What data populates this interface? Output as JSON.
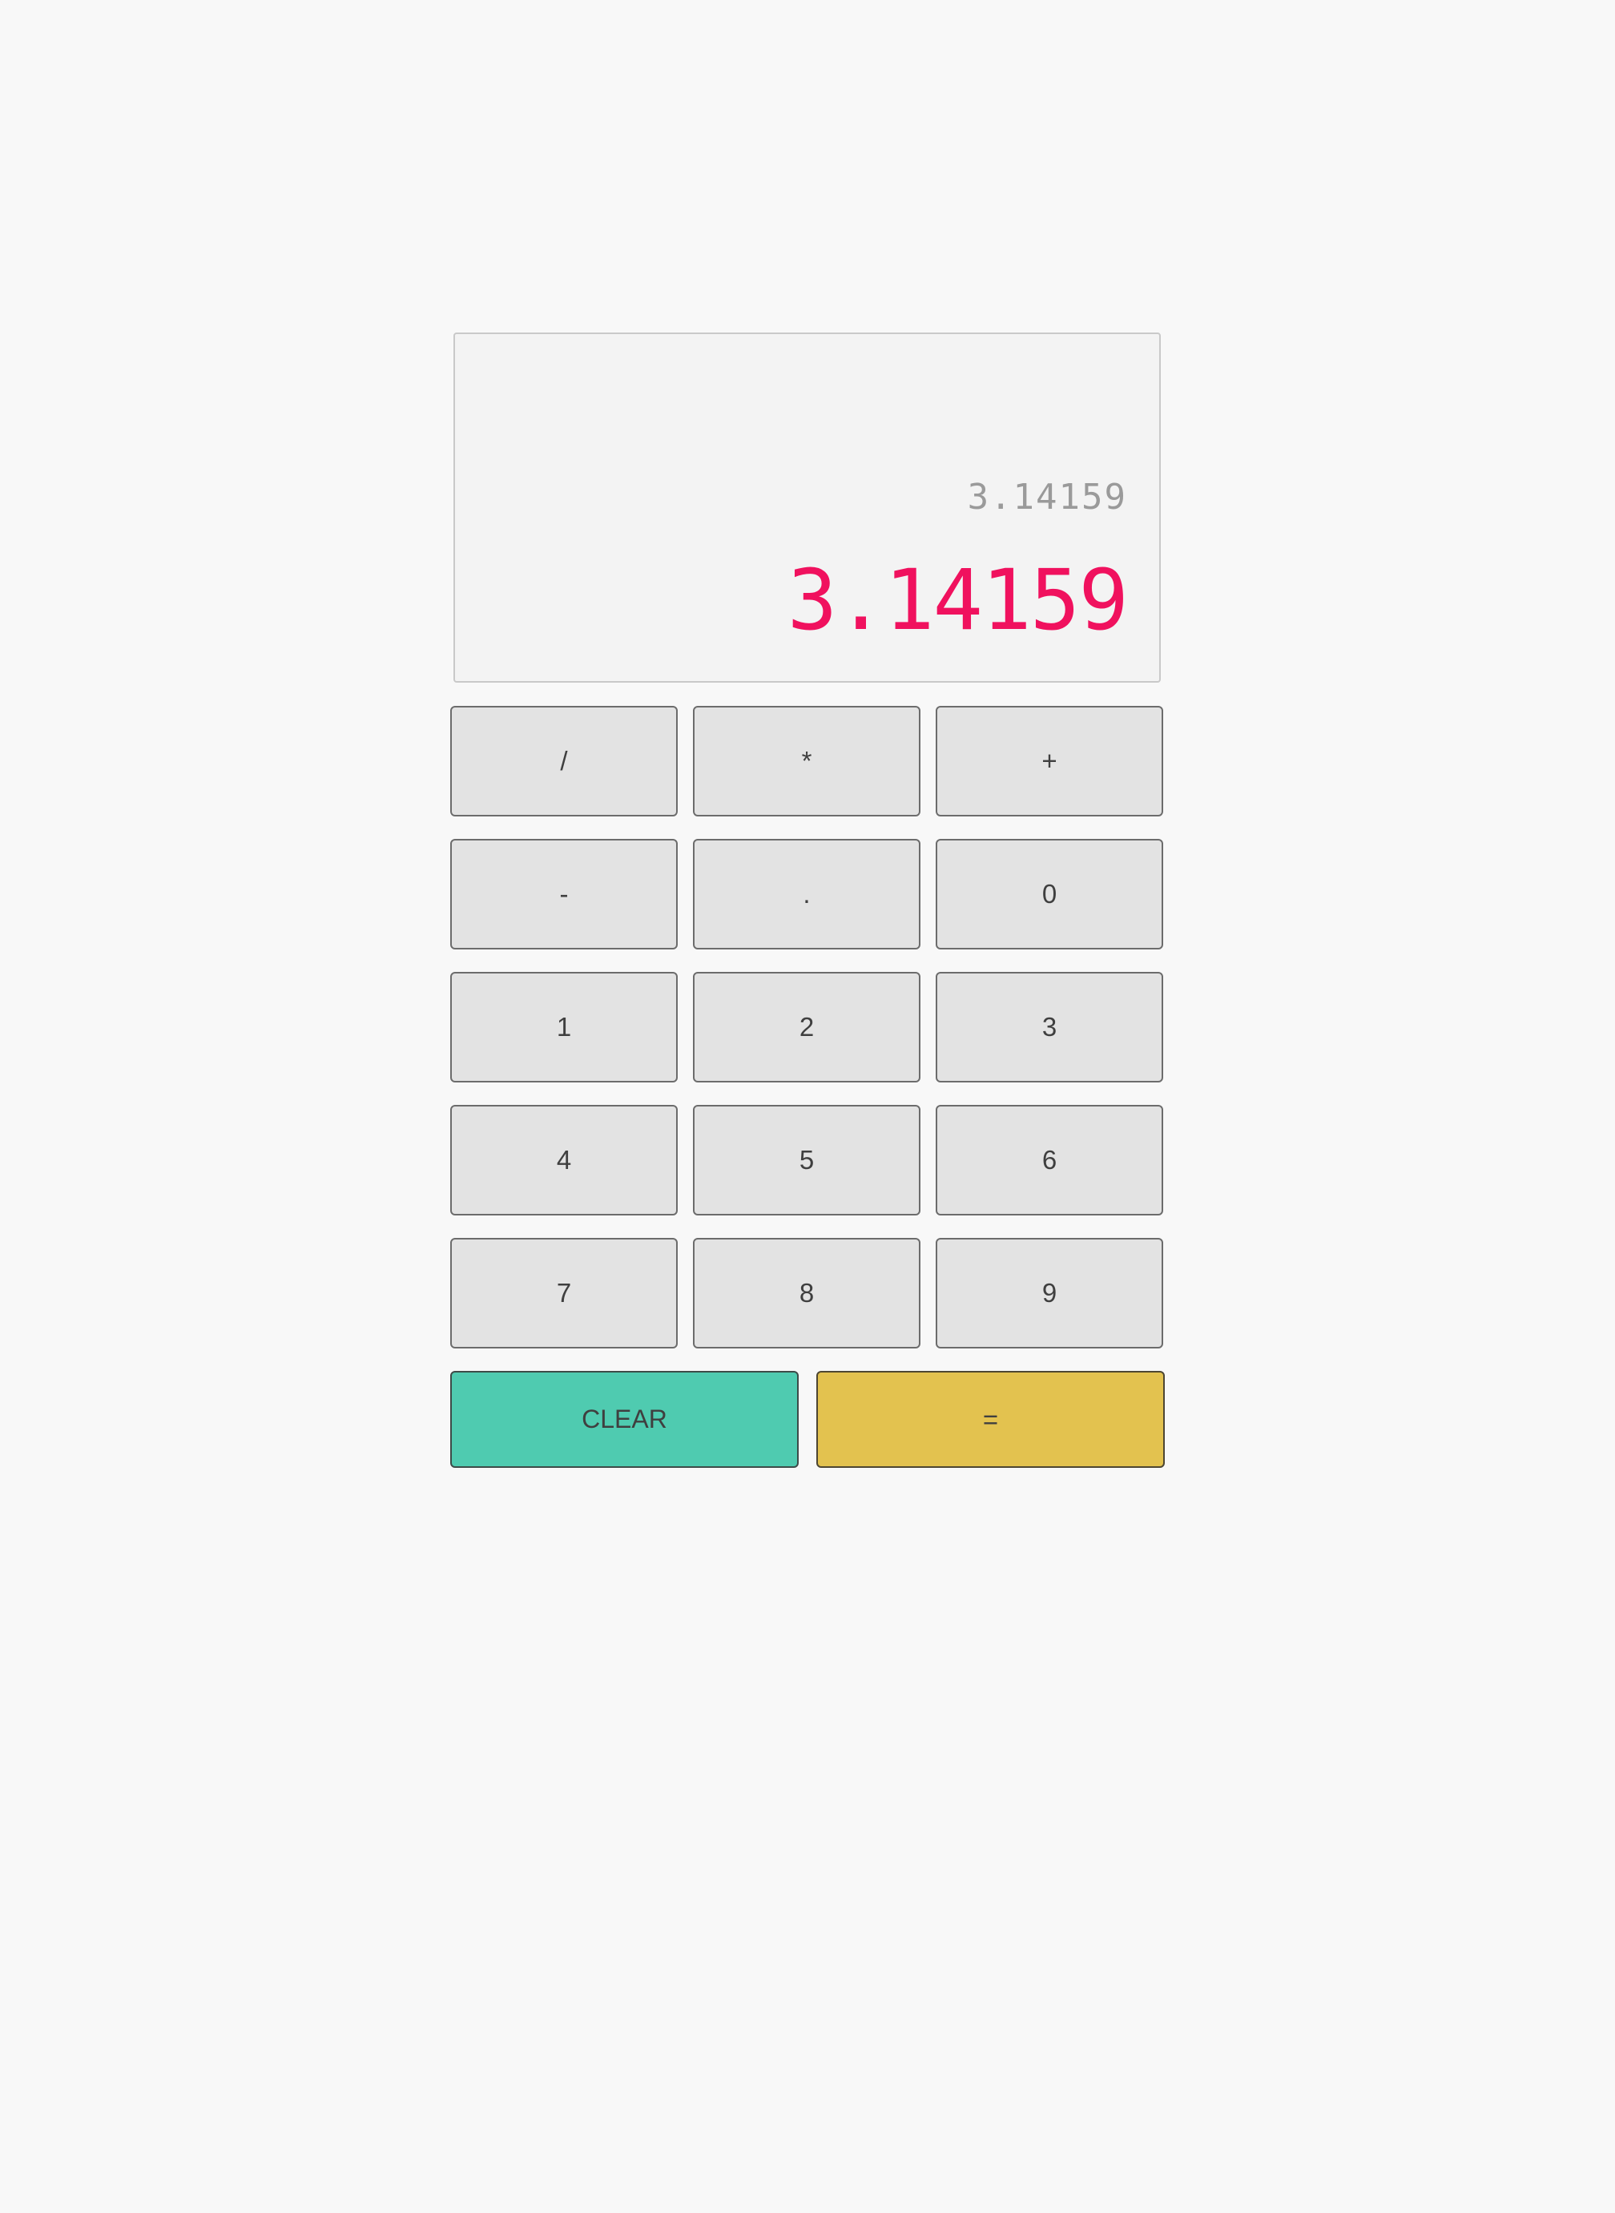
{
  "display": {
    "history": "3.14159",
    "current": "3.14159",
    "current_color": "#f0115e",
    "history_color": "#9a9a9a"
  },
  "keys": {
    "divide": "/",
    "multiply": "*",
    "add": "+",
    "subtract": "-",
    "decimal": ".",
    "digit_0": "0",
    "digit_1": "1",
    "digit_2": "2",
    "digit_3": "3",
    "digit_4": "4",
    "digit_5": "5",
    "digit_6": "6",
    "digit_7": "7",
    "digit_8": "8",
    "digit_9": "9",
    "clear": "CLEAR",
    "equals": "="
  },
  "colors": {
    "background": "#f8f8f8",
    "key_background": "#e3e3e3",
    "clear_background": "#4fcbb0",
    "equals_background": "#e3c24f"
  }
}
